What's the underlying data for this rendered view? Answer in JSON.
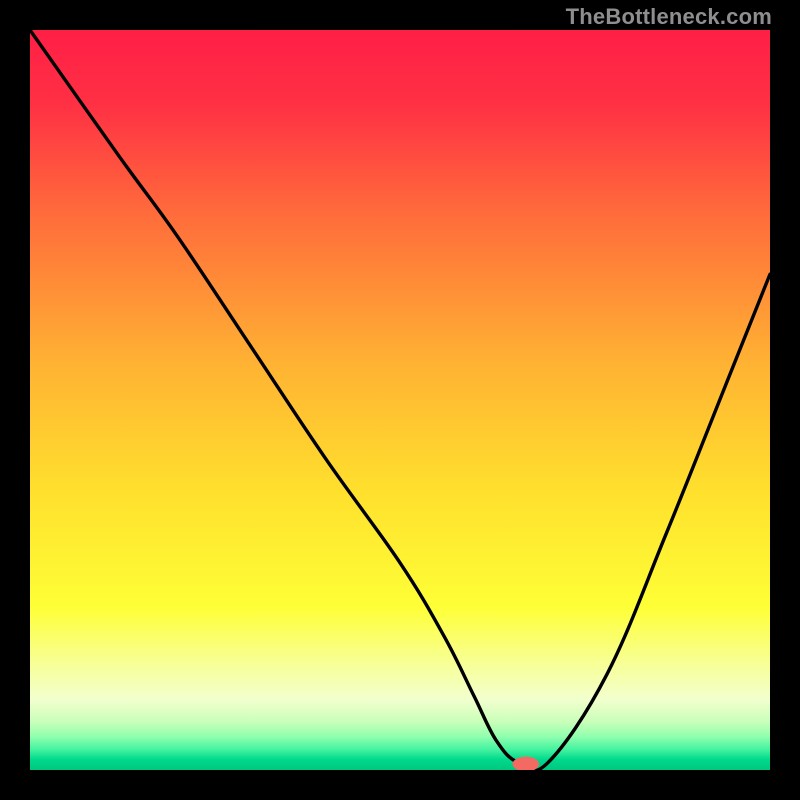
{
  "watermark": "TheBottleneck.com",
  "chart_data": {
    "type": "line",
    "title": "",
    "xlabel": "",
    "ylabel": "",
    "xlim": [
      0,
      100
    ],
    "ylim": [
      0,
      100
    ],
    "legend": null,
    "annotations": [],
    "background": {
      "kind": "vertical-gradient",
      "stops": [
        {
          "pos": 0.0,
          "color": "#ff1f46"
        },
        {
          "pos": 0.1,
          "color": "#ff3044"
        },
        {
          "pos": 0.25,
          "color": "#ff6c3b"
        },
        {
          "pos": 0.45,
          "color": "#ffb233"
        },
        {
          "pos": 0.62,
          "color": "#ffdf2d"
        },
        {
          "pos": 0.78,
          "color": "#feff36"
        },
        {
          "pos": 0.86,
          "color": "#f7ff9b"
        },
        {
          "pos": 0.905,
          "color": "#f2ffce"
        },
        {
          "pos": 0.935,
          "color": "#c9ffb9"
        },
        {
          "pos": 0.955,
          "color": "#8fffae"
        },
        {
          "pos": 0.972,
          "color": "#45f3a0"
        },
        {
          "pos": 0.986,
          "color": "#00d98d"
        },
        {
          "pos": 1.0,
          "color": "#00c77f"
        }
      ]
    },
    "series": [
      {
        "name": "bottleneck-curve",
        "color": "#000000",
        "x": [
          0,
          12,
          20,
          30,
          40,
          50,
          56,
          60,
          63,
          66,
          70,
          78,
          86,
          94,
          100
        ],
        "values": [
          100,
          83,
          72,
          57,
          42,
          28,
          18,
          10,
          4,
          1,
          1,
          13,
          32,
          52,
          67
        ]
      }
    ],
    "marker": {
      "name": "optimal-point",
      "x": 67,
      "y": 0.8,
      "color": "#f36a63",
      "rx": 1.8,
      "ry": 1.0
    }
  }
}
